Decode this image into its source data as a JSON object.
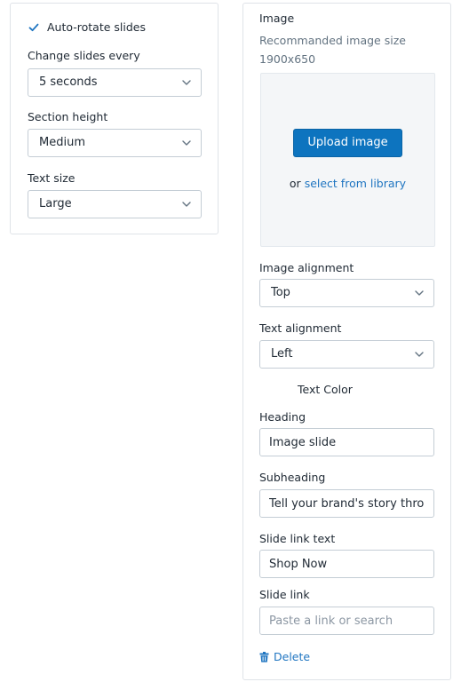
{
  "slideshow_settings": {
    "autorotate": {
      "label": "Auto-rotate slides",
      "checked": true
    },
    "change_every": {
      "label": "Change slides every",
      "value": "5 seconds"
    },
    "section_height": {
      "label": "Section height",
      "value": "Medium"
    },
    "text_size": {
      "label": "Text size",
      "value": "Large"
    }
  },
  "slide": {
    "image": {
      "label": "Image",
      "hint_line1": "Recommanded image size",
      "hint_line2": "1900x650",
      "upload_label": "Upload image",
      "or_text": "or",
      "library_link": "select from library"
    },
    "image_alignment": {
      "label": "Image alignment",
      "value": "Top"
    },
    "text_alignment": {
      "label": "Text alignment",
      "value": "Left"
    },
    "text_color": {
      "label": "Text Color"
    },
    "heading": {
      "label": "Heading",
      "value": "Image slide"
    },
    "subheading": {
      "label": "Subheading",
      "value": "Tell your brand's story through images"
    },
    "slide_link_text": {
      "label": "Slide link text",
      "value": "Shop Now"
    },
    "slide_link": {
      "label": "Slide link",
      "placeholder": "Paste a link or search"
    },
    "delete_label": "Delete"
  },
  "colors": {
    "primary_button": "#0d74bf",
    "link": "#1f75c1",
    "border": "#c4cdd5"
  },
  "icons": {
    "checkbox": "checkmark-icon",
    "select": "chevron-down-icon",
    "delete": "trash-icon"
  }
}
